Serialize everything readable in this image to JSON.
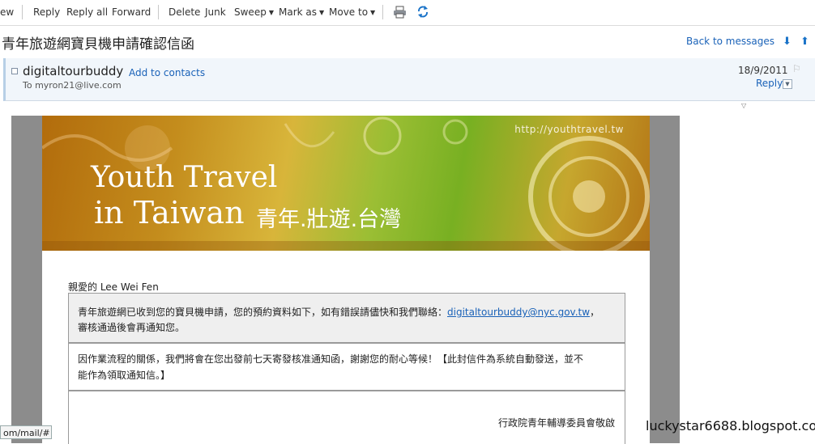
{
  "toolbar": {
    "view": "ew",
    "reply": "Reply",
    "reply_all": "Reply all",
    "forward": "Forward",
    "delete": "Delete",
    "junk": "Junk",
    "sweep": "Sweep",
    "mark_as": "Mark as",
    "move_to": "Move to",
    "print_icon": "printer-icon",
    "refresh_icon": "refresh-icon"
  },
  "message": {
    "subject": "青年旅遊網寶貝機申請確認信函",
    "back_link": "Back to messages",
    "sender": "digitaltourbuddy",
    "add_contacts": "Add to contacts",
    "to": "To myron21@live.com",
    "date": "18/9/2011",
    "reply": "Reply"
  },
  "email": {
    "banner_url": "http://youthtravel.tw",
    "banner_title_1": "Youth Travel",
    "banner_title_2": "in Taiwan",
    "banner_chinese": "青年.壯遊.台灣",
    "salutation": "親愛的 Lee Wei Fen",
    "box1_text": "青年旅遊網已收到您的寶貝機申請，您的預約資料如下，如有錯誤請儘快和我們聯絡：",
    "box1_link": "digitaltourbuddy@nyc.gov.tw",
    "box1_tail": "，",
    "box1_line2": "審核通過後會再通知您。",
    "box2_line1": "因作業流程的關係，我們將會在您出發前七天寄發核准通知函，謝謝您的耐心等候！【此封信件為系統自動發送，並不",
    "box2_line2": "能作為領取通知信。】",
    "signature": "行政院青年輔導委員會敬啟"
  },
  "watermark": "luckystar6688.blogspot.com",
  "status_bar": "om/mail/#"
}
